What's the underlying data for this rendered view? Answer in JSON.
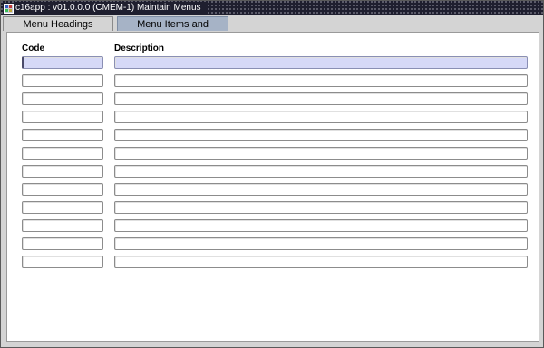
{
  "window": {
    "title": "c16app : v01.0.0.0 (CMEM-1) Maintain Menus",
    "icon": "app-icon"
  },
  "tabs": [
    {
      "label": "Menu Headings",
      "active": true
    },
    {
      "label": "Menu Items and Positions",
      "active": false
    }
  ],
  "grid": {
    "columns": {
      "code": "Code",
      "description": "Description"
    },
    "rows": [
      {
        "code": "",
        "description": ""
      },
      {
        "code": "",
        "description": ""
      },
      {
        "code": "",
        "description": ""
      },
      {
        "code": "",
        "description": ""
      },
      {
        "code": "",
        "description": ""
      },
      {
        "code": "",
        "description": ""
      },
      {
        "code": "",
        "description": ""
      },
      {
        "code": "",
        "description": ""
      },
      {
        "code": "",
        "description": ""
      },
      {
        "code": "",
        "description": ""
      },
      {
        "code": "",
        "description": ""
      },
      {
        "code": "",
        "description": ""
      }
    ],
    "selected_row": 0
  },
  "colors": {
    "titlebar": "#1f1f2f",
    "active_tab": "#d4d4d4",
    "inactive_tab": "#a6b3c6",
    "selected_field": "#d6d9f7"
  }
}
